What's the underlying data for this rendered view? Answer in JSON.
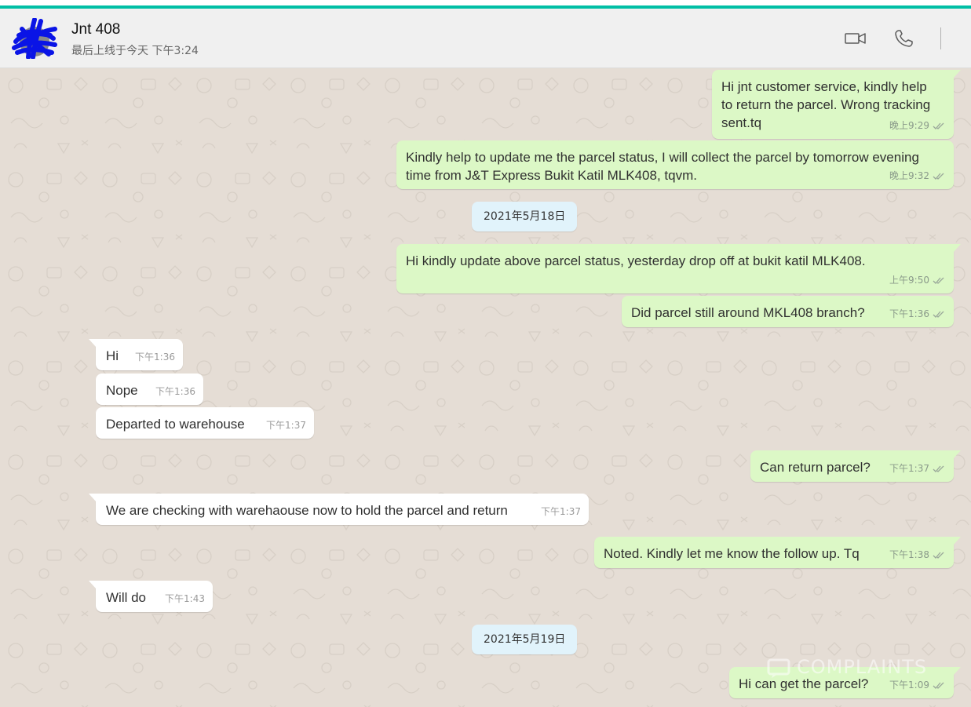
{
  "header": {
    "contact_name": "Jnt 408",
    "last_seen": "最后上线于今天 下午3:24",
    "icons": [
      "video-call-icon",
      "voice-call-icon"
    ]
  },
  "colors": {
    "accent": "#00bfa5",
    "outgoing_bubble": "#dcf8c6",
    "incoming_bubble": "#ffffff",
    "date_chip": "#e1f3fb",
    "wallpaper": "#e5ddd5",
    "avatar_scribble": "#0a14e6"
  },
  "messages": [
    {
      "direction": "out",
      "text": "Hi jnt customer service, kindly help\nto return the parcel. Wrong tracking\nsent.tq",
      "time": "晚上9:29"
    },
    {
      "direction": "out",
      "text": "Kindly help to update me the parcel status, I will collect the parcel by tomorrow evening\ntime from J&T Express Bukit Katil MLK408, tqvm.",
      "time": "晚上9:32"
    },
    {
      "type": "date",
      "text": "2021年5月18日"
    },
    {
      "direction": "out",
      "text": "Hi kindly update above parcel status, yesterday drop off at bukit katil MLK408.",
      "time": "上午9:50"
    },
    {
      "direction": "out",
      "text": "Did parcel still around MKL408 branch?",
      "time": "下午1:36"
    },
    {
      "direction": "in",
      "text": "Hi",
      "time": "下午1:36"
    },
    {
      "direction": "in",
      "text": "Nope",
      "time": "下午1:36"
    },
    {
      "direction": "in",
      "text": "Departed to warehouse",
      "time": "下午1:37"
    },
    {
      "direction": "out",
      "text": "Can return parcel?",
      "time": "下午1:37"
    },
    {
      "direction": "in",
      "text": "We are checking with warehaouse now to hold the parcel and return",
      "time": "下午1:37"
    },
    {
      "direction": "out",
      "text": "Noted. Kindly let me know the follow up. Tq",
      "time": "下午1:38"
    },
    {
      "direction": "in",
      "text": "Will do",
      "time": "下午1:43"
    },
    {
      "type": "date",
      "text": "2021年5月19日"
    },
    {
      "direction": "out",
      "text": "Hi can get the parcel?",
      "time": "下午1:09"
    }
  ],
  "watermark": {
    "text": "COMPLAINTS"
  }
}
